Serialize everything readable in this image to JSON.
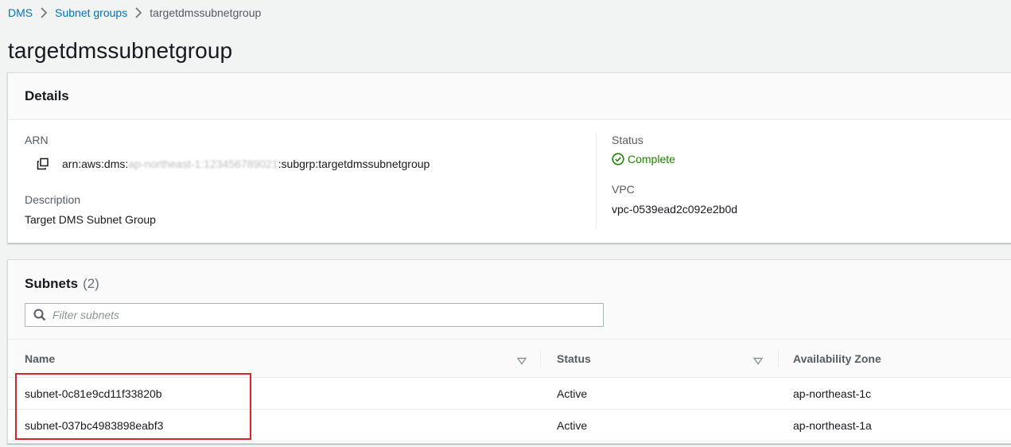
{
  "breadcrumb": {
    "root": "DMS",
    "parent": "Subnet groups",
    "current": "targetdmssubnetgroup"
  },
  "page": {
    "title": "targetdmssubnetgroup"
  },
  "details": {
    "header": "Details",
    "arn_label": "ARN",
    "arn_prefix": "arn:aws:dms:",
    "arn_redacted": "ap-northeast-1:123456789021",
    "arn_suffix": ":subgrp:targetdmssubnetgroup",
    "description_label": "Description",
    "description": "Target DMS Subnet Group",
    "status_label": "Status",
    "status": "Complete",
    "vpc_label": "VPC",
    "vpc": "vpc-0539ead2c092e2b0d"
  },
  "subnets": {
    "title": "Subnets",
    "count": "(2)",
    "filter_placeholder": "Filter subnets",
    "columns": {
      "name": "Name",
      "status": "Status",
      "az": "Availability Zone"
    },
    "rows": [
      {
        "name": "subnet-0c81e9cd11f33820b",
        "status": "Active",
        "az": "ap-northeast-1c"
      },
      {
        "name": "subnet-037bc4983898eabf3",
        "status": "Active",
        "az": "ap-northeast-1a"
      }
    ]
  },
  "colors": {
    "link": "#0073bb",
    "success": "#1d8102",
    "highlight": "#d6242f"
  },
  "icons": {
    "breadcrumb_separator": "chevron-right-icon",
    "copy": "copy-icon",
    "status": "check-circle-icon",
    "search": "search-icon",
    "sort": "caret-down-icon"
  }
}
